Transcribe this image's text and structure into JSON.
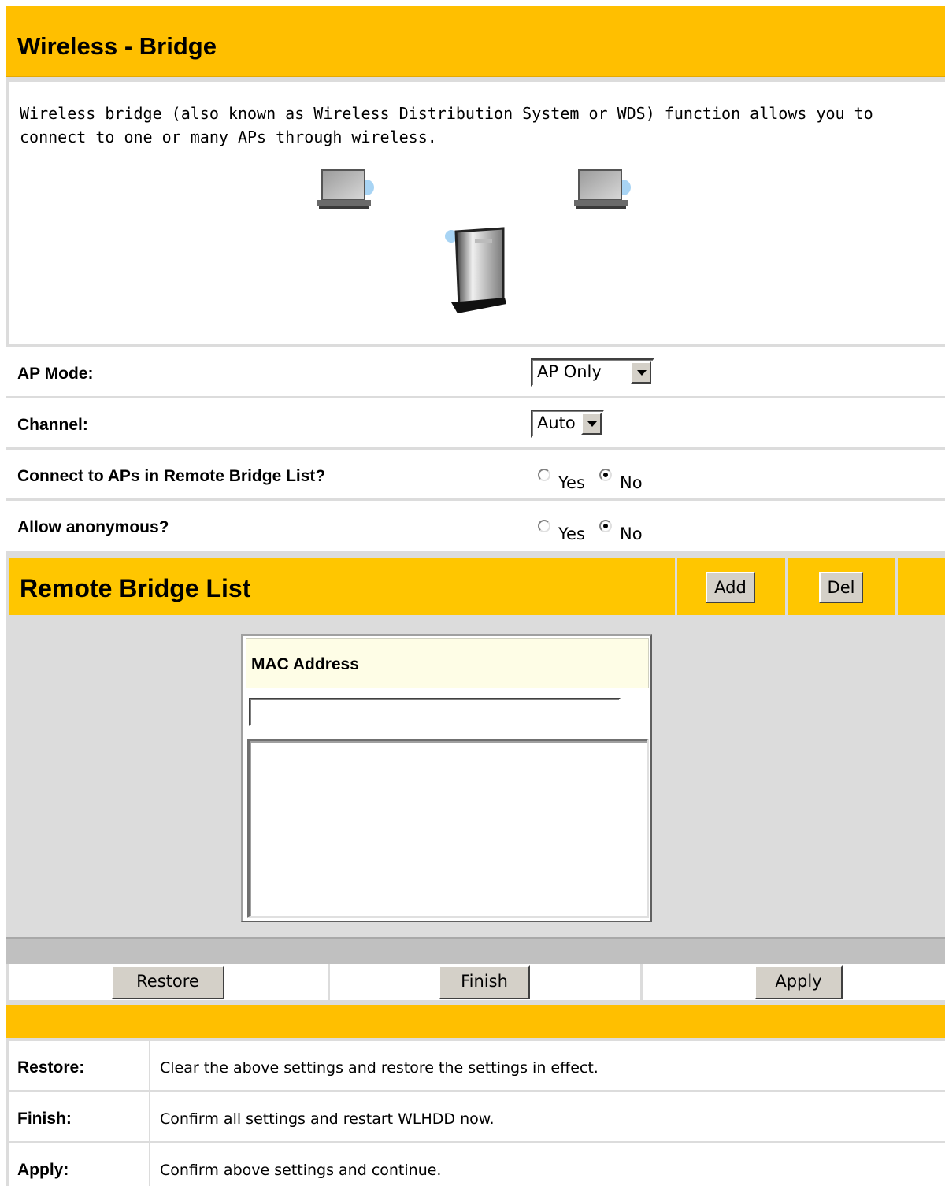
{
  "header": {
    "title": "Wireless - Bridge"
  },
  "description": "Wireless bridge (also known as Wireless Distribution System or WDS) function allows you to connect to one or many APs through wireless.",
  "diagram": {
    "devices": [
      "laptop-icon",
      "laptop-icon",
      "router-icon"
    ]
  },
  "settings": {
    "ap_mode": {
      "label": "AP Mode:",
      "value": "AP Only"
    },
    "channel": {
      "label": "Channel:",
      "value": "Auto"
    },
    "connect_remote": {
      "label": "Connect to APs in Remote Bridge List?",
      "yes": "Yes",
      "no": "No",
      "selected": "No"
    },
    "allow_anonymous": {
      "label": "Allow anonymous?",
      "yes": "Yes",
      "no": "No",
      "selected": "No"
    }
  },
  "remote_bridge": {
    "title": "Remote Bridge List",
    "add_label": "Add",
    "del_label": "Del",
    "column_header": "MAC Address",
    "mac_input_value": "",
    "entries": []
  },
  "actions": {
    "restore": "Restore",
    "finish": "Finish",
    "apply": "Apply"
  },
  "help": [
    {
      "key": "Restore:",
      "text": "Clear the above settings and restore the settings in effect."
    },
    {
      "key": "Finish:",
      "text": "Confirm all settings and restart WLHDD now."
    },
    {
      "key": "Apply:",
      "text": "Confirm above settings and continue."
    }
  ],
  "colors": {
    "accent": "#ffbf00",
    "accent_bar": "#ffc600",
    "border": "#dcdcdc"
  }
}
